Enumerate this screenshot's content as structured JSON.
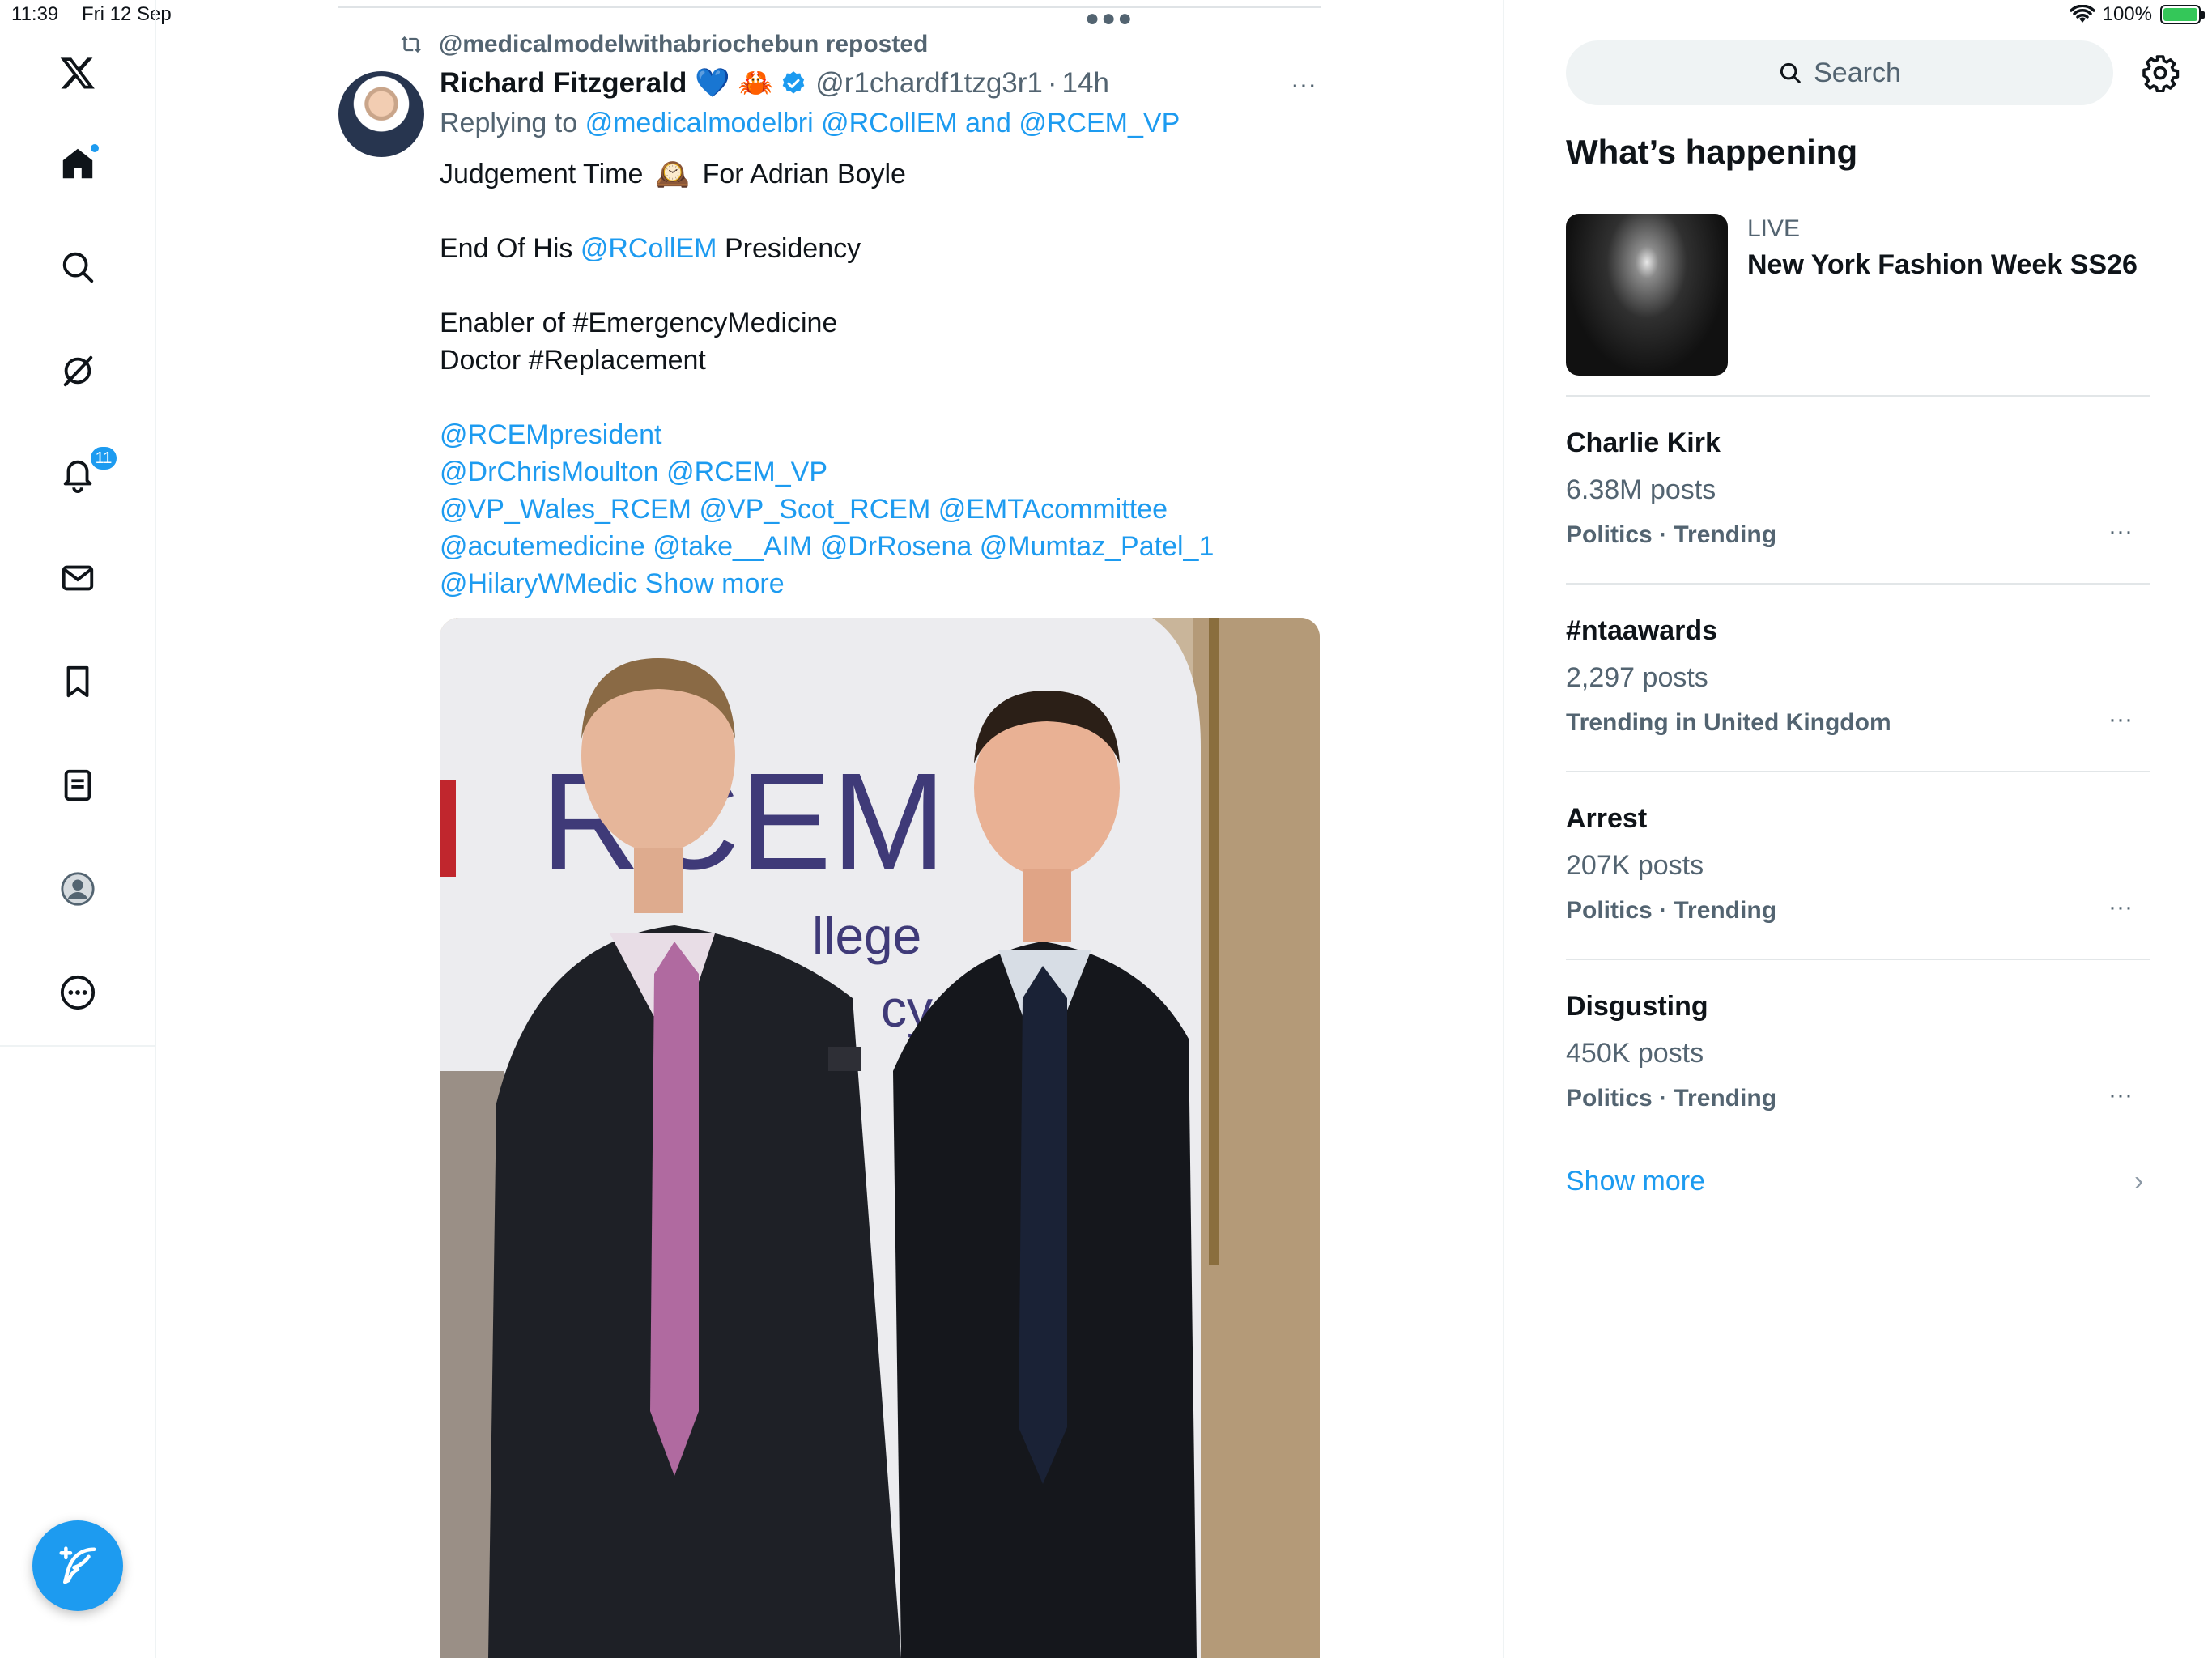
{
  "status_bar": {
    "time": "11:39",
    "date": "Fri 12 Sep",
    "battery": "100%",
    "battery_level": 1.0
  },
  "nav": {
    "logo": "x-logo-icon",
    "items": [
      "home-icon",
      "search-icon",
      "grok-icon",
      "notifications-icon",
      "messages-icon",
      "bookmarks-icon",
      "lists-icon",
      "profile-icon",
      "more-icon"
    ],
    "notifications_badge": "11",
    "compose": "compose-icon"
  },
  "tweet": {
    "repost_label": "@medicalmodelwithabriochebun reposted",
    "author_name": "Richard Fitzgerald",
    "author_emojis": "💙 🦀",
    "author_handle": "@r1chardf1tzg3r1",
    "separator": "·",
    "time": "14h",
    "more": "···",
    "replying_prefix": "Replying to",
    "reply_user_1": "@medicalmodelbri",
    "reply_user_2": "@RCollEM",
    "reply_and": "and",
    "reply_user_3": "@RCEM_VP",
    "line1_a": "Judgement Time",
    "line1_emoji": "🕰️",
    "line1_b": "For Adrian Boyle",
    "line2_a": "End Of His",
    "line2_link": "@RCollEM",
    "line2_b": "Presidency",
    "line3": "Enabler of #EmergencyMedicine",
    "line4": "Doctor #Replacement",
    "mention_line1": "@RCEMpresident",
    "mention_line2": "@DrChrisMoulton @RCEM_VP",
    "mention_line3": "@VP_Wales_RCEM @VP_Scot_RCEM @EMTAcommittee",
    "mention_line4": "@acutemedicine @take__AIM @DrRosena @Mumtaz_Patel_1",
    "mention_line5": "@HilaryWMedic",
    "show_more": "Show more",
    "photo": {
      "backdrop_text_1": "RCEM",
      "backdrop_text_2": "llege",
      "backdrop_text_3": "cy"
    }
  },
  "sidebar": {
    "search_placeholder": "Search",
    "title": "What’s happening",
    "live": {
      "label": "LIVE",
      "title": "New York Fashion Week SS26"
    },
    "trends": [
      {
        "name": "Charlie Kirk",
        "count": "6.38M posts",
        "context": "Politics · Trending"
      },
      {
        "name": "#ntaawards",
        "count": "2,297 posts",
        "context": "Trending in United Kingdom"
      },
      {
        "name": "Arrest",
        "count": "207K posts",
        "context": "Politics · Trending"
      },
      {
        "name": "Disgusting",
        "count": "450K posts",
        "context": "Politics · Trending"
      }
    ],
    "more_dots": "···",
    "show_more": "Show more",
    "show_more_chevron": "›"
  },
  "colors": {
    "accent": "#1d9bf0",
    "text": "#0f1419",
    "muted": "#536471",
    "border": "#eff3f4"
  }
}
